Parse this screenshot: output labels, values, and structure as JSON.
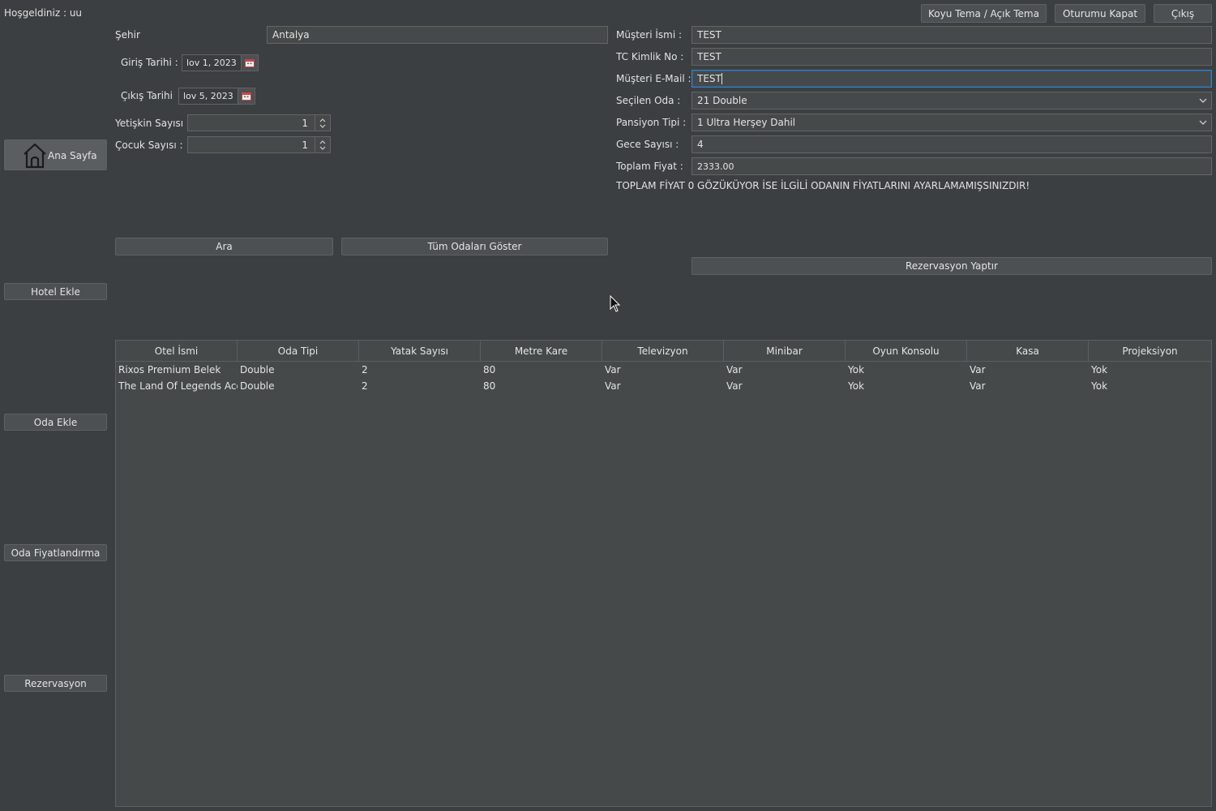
{
  "header": {
    "welcome": "Hoşgeldiniz : uu",
    "theme_button": "Koyu Tema / Açık Tema",
    "logout_button": "Oturumu Kapat",
    "exit_button": "Çıkış"
  },
  "sidebar": {
    "home": "Ana Sayfa",
    "add_hotel": "Hotel Ekle",
    "add_room": "Oda Ekle",
    "room_pricing": "Oda Fiyatlandırma",
    "reservation": "Rezervasyon"
  },
  "search": {
    "city_label": "Şehir",
    "city_value": "Antalya",
    "checkin_label": "Giriş Tarihi :",
    "checkin_value": "lov 1, 2023",
    "checkout_label": "Çıkış Tarihi",
    "checkout_value": "lov 5, 2023",
    "adults_label": "Yetişkin Sayısı :",
    "adults_value": "1",
    "children_label": "Çocuk Sayısı :",
    "children_value": "1",
    "search_button": "Ara",
    "show_all_button": "Tüm Odaları Göster"
  },
  "customer": {
    "name_label": "Müşteri İsmi :",
    "name_value": "TEST",
    "tc_label": "TC Kimlik No :",
    "tc_value": "TEST",
    "email_label": "Müşteri E-Mail :",
    "email_value": "TEST",
    "room_label": "Seçilen Oda :",
    "room_value": "21 Double",
    "board_label": "Pansiyon Tipi :",
    "board_value": "1 Ultra Herşey Dahil",
    "nights_label": "Gece Sayısı :",
    "nights_value": "4",
    "total_label": "Toplam Fiyat :",
    "total_value": "2333.00",
    "warning": "TOPLAM FİYAT 0 GÖZÜKÜYOR İSE İLGİLİ ODANIN FİYATLARINI AYARLAMAMIŞSINIZDIR!",
    "reserve_button": "Rezervasyon Yaptır"
  },
  "table": {
    "headers": [
      "Otel İsmi",
      "Oda Tipi",
      "Yatak Sayısı",
      "Metre Kare",
      "Televizyon",
      "Minibar",
      "Oyun Konsolu",
      "Kasa",
      "Projeksiyon"
    ],
    "rows": [
      [
        "Rixos Premium Belek",
        "Double",
        "2",
        "80",
        "Var",
        "Var",
        "Yok",
        "Var",
        "Yok"
      ],
      [
        "The Land Of Legends Acc...",
        "Double",
        "2",
        "80",
        "Var",
        "Var",
        "Yok",
        "Var",
        "Yok"
      ]
    ]
  },
  "icons": {
    "home": "home-icon",
    "calendar": "calendar-icon",
    "spinner": "spinner-arrows-icon",
    "dropdown": "chevron-down-icon",
    "cursor": "mouse-cursor-icon"
  },
  "colors": {
    "background": "#3c3f41",
    "field": "#45494a",
    "button": "#4c5052",
    "focus": "#3d7fbf"
  }
}
